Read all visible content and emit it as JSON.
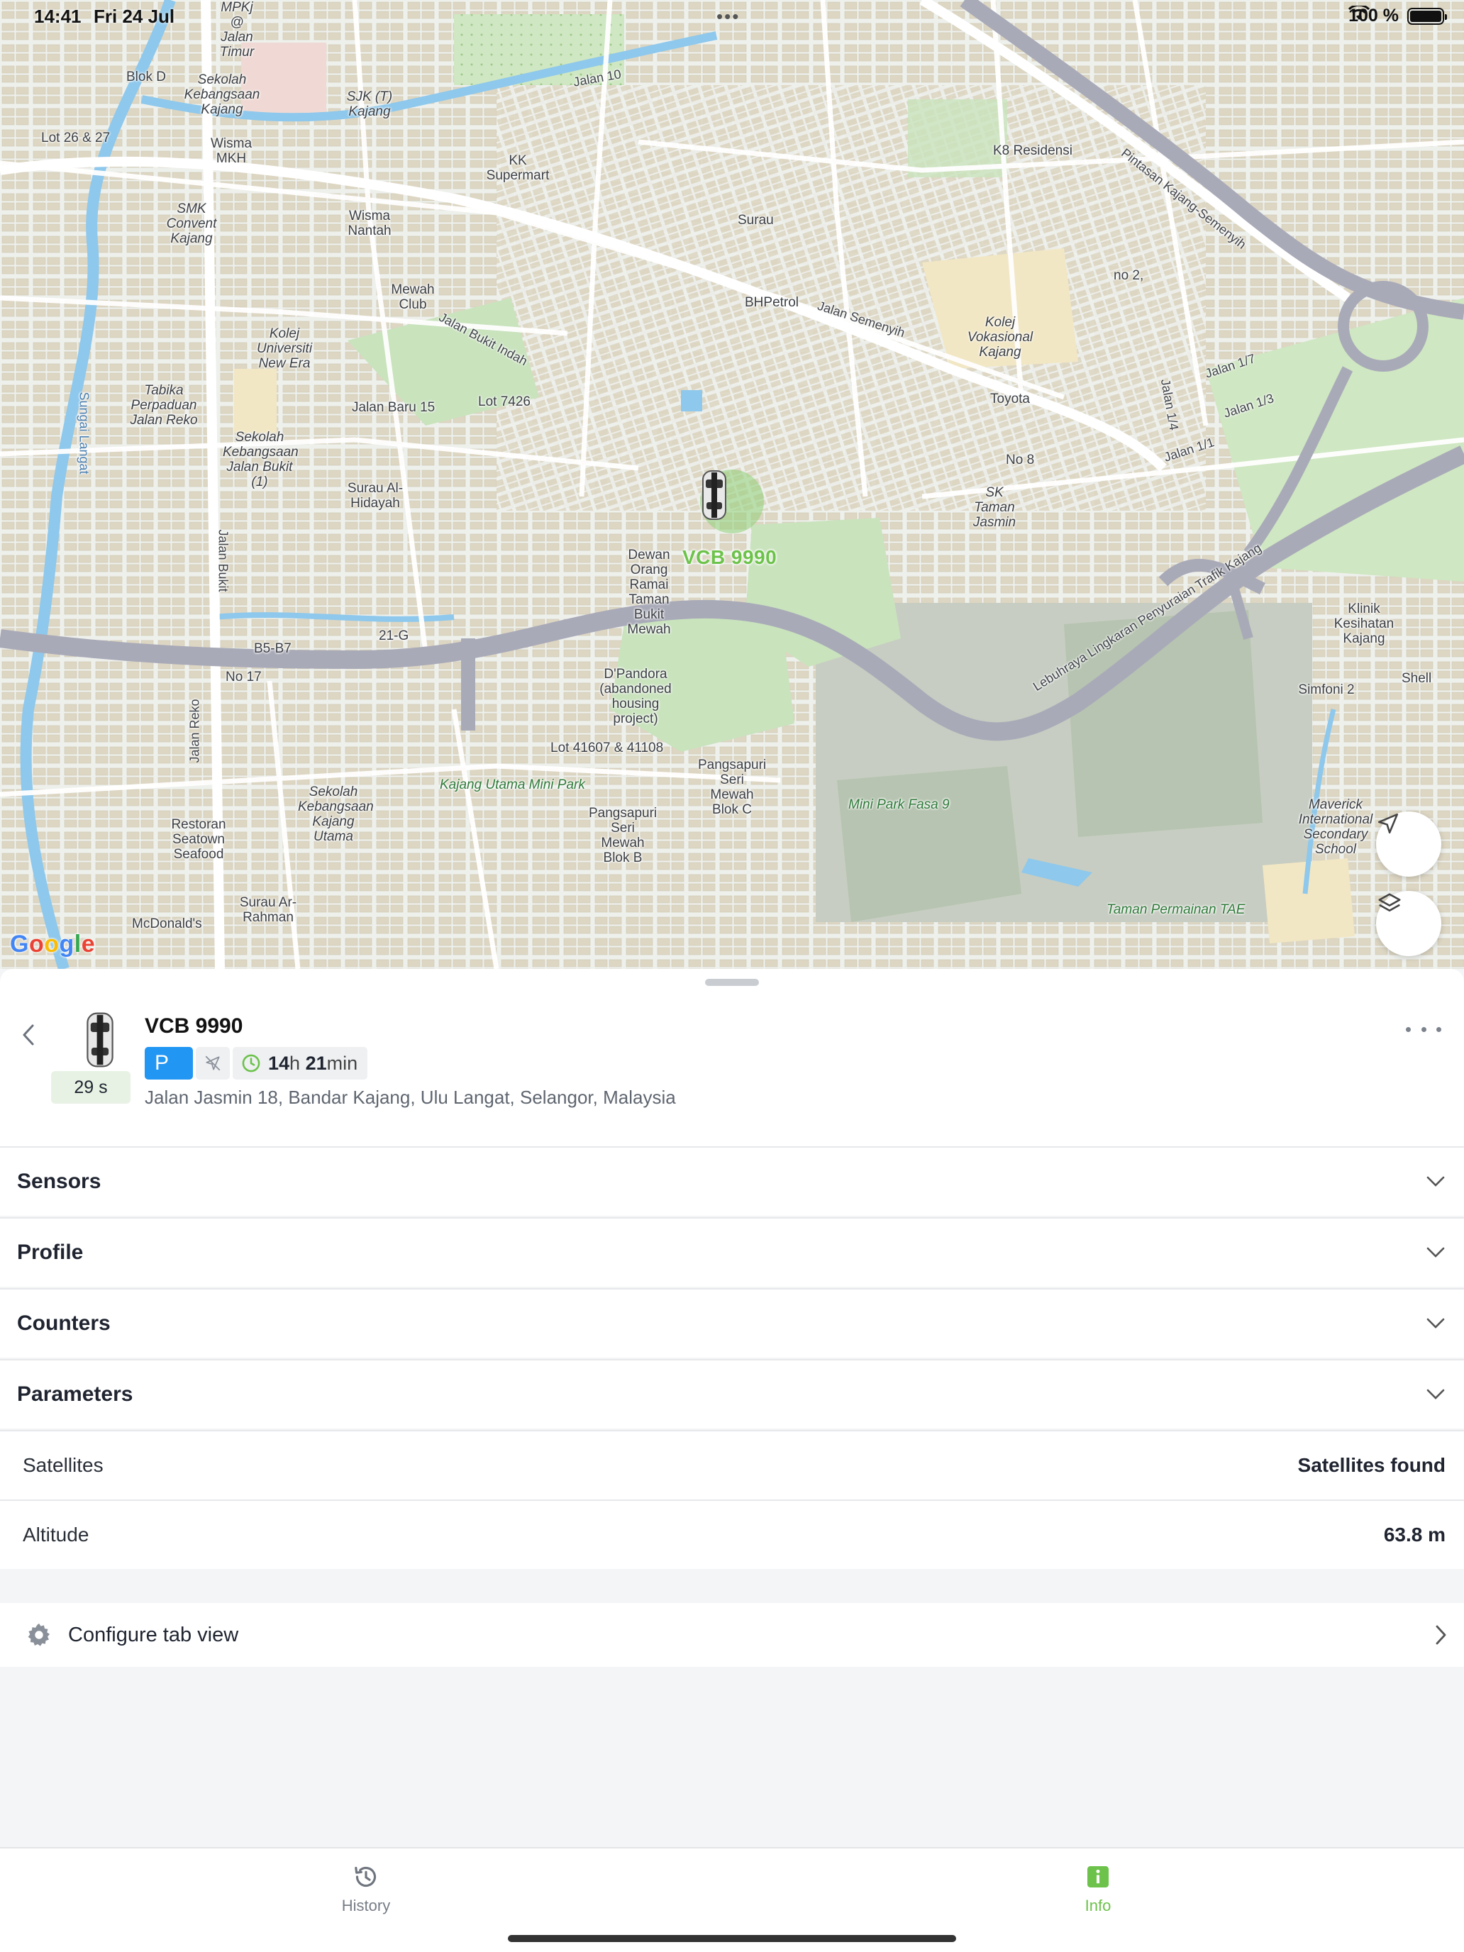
{
  "status_bar": {
    "time": "14:41",
    "date": "Fri 24 Jul",
    "battery": "100 %"
  },
  "map": {
    "provider": "Google",
    "vehicle_label": "VCB 9990",
    "labels": {
      "jalan_semenyih": "Jalan Semenyih",
      "k8_residensi": "K8 Residensi",
      "pintasan": "Pintasan Kajang-Semenyih",
      "surau": "Surau",
      "bhpetrol": "BHPetrol",
      "kolej_vokasional": "Kolej Vokasional Kajang",
      "toyota": "Toyota",
      "sk_taman_jasmin": "SK Taman Jasmin",
      "dewan": "Dewan Orang Ramai Taman Bukit Mewah",
      "dpandora": "D'Pandora (abandoned housing project)",
      "lot_41607": "Lot 41607 & 41108",
      "kajang_utama_mini_park": "Kajang Utama Mini Park",
      "mini_park_fasa_9": "Mini Park Fasa 9",
      "pangsapuri_c": "Pangsapuri Seri Mewah Blok C",
      "pangsapuri_b": "Pangsapuri Seri Mewah Blok B",
      "sekolah_kebangsaan_kajang_utama": "Sekolah Kebangsaan Kajang Utama",
      "restoran": "Restoran Seatown Seafood",
      "surau_ar_rahman": "Surau Ar-Rahman",
      "mcdonalds": "McDonald's",
      "taman_permainan": "Taman Permainan TAE",
      "maverick": "Maverick International Secondary School",
      "klinik": "Klinik Kesihatan Kajang",
      "shell": "Shell",
      "simfoni": "Simfoni 2",
      "lebuhraya": "Lebuhraya Lingkaran Penyuraian Trafik Kajang",
      "jalan_reko": "Jalan Reko",
      "jalan_bukit": "Jalan Bukit",
      "sungai_langat": "Sungai Langat",
      "sekolah_jalan_bukit": "Sekolah Kebangsaan Jalan Bukit (1)",
      "surau_al_hidayah": "Surau Al-Hidayah",
      "lot_7426": "Lot 7426",
      "jalan_baru_15": "Jalan Baru 15",
      "kolej_universiti": "Kolej Universiti New Era",
      "tabika": "Tabika Perpaduan Jalan Reko",
      "mewah_club": "Mewah Club",
      "wisma_nantah": "Wisma Nantah",
      "smk_convent": "SMK Convent Kajang",
      "sjk_t": "SJK (T) Kajang",
      "kk_supermart": "KK Supermart",
      "sekolah_kebangsaan_kajang": "Sekolah Kebangsaan Kajang",
      "jalan_bukit_indah": "Jalan Bukit Indah",
      "no_17": "No 17",
      "b5_b7": "B5-B7",
      "21_g": "21-G",
      "no_8": "No 8",
      "no_2": "no 2,",
      "jalan_1_4": "Jalan 1/4",
      "jalan_1_7": "Jalan 1/7",
      "jalan_1_3": "Jalan 1/3",
      "jalan_1_1": "Jalan 1/1",
      "jalan_10": "Jalan 10",
      "wisma_mkh": "Wisma MKH",
      "mpkj": "MPKj @ Jalan Timur",
      "blok_d": "Blok D",
      "lot_26_27": "Lot 26 & 27"
    }
  },
  "unit": {
    "name": "VCB 9990",
    "last_update": "29 s",
    "status_chip": "P",
    "duration_hours": "14",
    "duration_hours_unit": "h",
    "duration_minutes": "21",
    "duration_minutes_unit": "min",
    "address": "Jalan Jasmin 18, Bandar Kajang, Ulu Langat, Selangor, Malaysia"
  },
  "sections": [
    {
      "title": "Sensors"
    },
    {
      "title": "Profile"
    },
    {
      "title": "Counters"
    },
    {
      "title": "Parameters"
    }
  ],
  "parameters": [
    {
      "label": "Satellites",
      "value": "Satellites found"
    },
    {
      "label": "Altitude",
      "value": "63.8 m"
    }
  ],
  "configure": {
    "label": "Configure tab view",
    "icon": "gear-icon"
  },
  "tabbar": {
    "tabs": [
      {
        "label": "History",
        "icon": "history-icon",
        "active": false
      },
      {
        "label": "Info",
        "icon": "info-icon",
        "active": true
      }
    ]
  },
  "colors": {
    "accent": "#6cc24a",
    "parking_chip": "#2196f3",
    "road_highway": "#a9aab8",
    "building": "#dfd8c6",
    "park": "#c9e3bd",
    "water": "#8ec8ec"
  }
}
